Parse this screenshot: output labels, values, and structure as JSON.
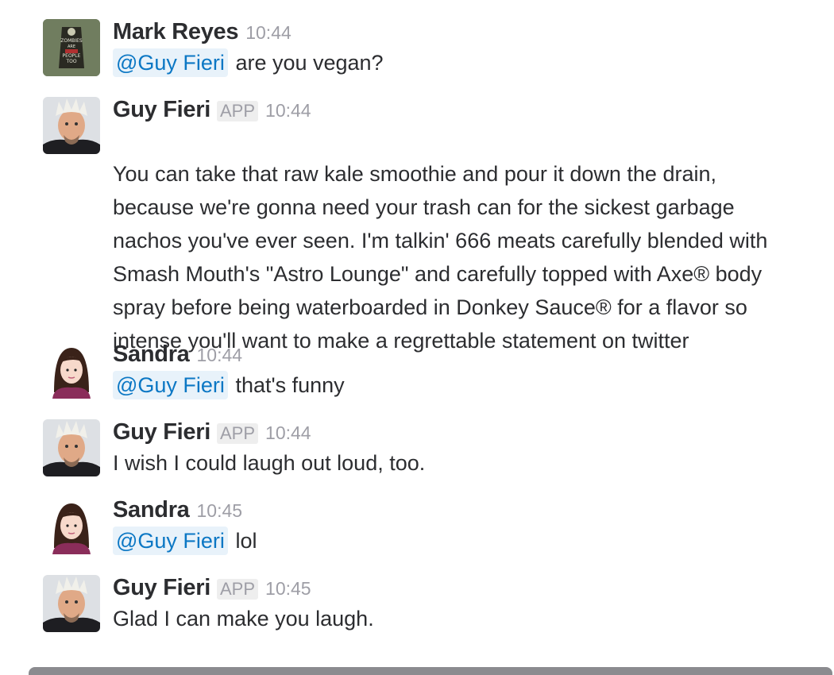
{
  "messages": [
    {
      "author": "Mark Reyes",
      "badge": "",
      "time": "10:44",
      "mention": "@Guy Fieri",
      "text": " are you vegan?",
      "avatar": "zombies-poster-avatar",
      "avatar_text": [
        "ZOMBIES",
        "ARE",
        "PEOPLE",
        "TOO"
      ]
    },
    {
      "author": "Guy Fieri",
      "badge": "APP",
      "time": "10:44",
      "mention": "",
      "text": "You can take that raw kale smoothie and pour it down the drain,\nbecause we're gonna need your trash can for the sickest garbage\nnachos you've ever seen. I'm talkin' 666 meats carefully blended with\nSmash Mouth's \"Astro Lounge\" and carefully topped with Axe® body\nspray before being waterboarded in Donkey Sauce® for a flavor so\nintense you'll want to make a regrettable statement on twitter",
      "avatar": "guy-fieri-avatar"
    },
    {
      "author": "Sandra",
      "badge": "",
      "time": "10:44",
      "mention": "@Guy Fieri",
      "text": " that's funny",
      "avatar": "woman-cartoon-avatar"
    },
    {
      "author": "Guy Fieri",
      "badge": "APP",
      "time": "10:44",
      "mention": "",
      "text": "I wish I could laugh out loud, too.",
      "avatar": "guy-fieri-avatar"
    },
    {
      "author": "Sandra",
      "badge": "",
      "time": "10:45",
      "mention": "@Guy Fieri",
      "text": " lol",
      "avatar": "woman-cartoon-avatar"
    },
    {
      "author": "Guy Fieri",
      "badge": "APP",
      "time": "10:45",
      "mention": "",
      "text": "Glad I can make you laugh.",
      "avatar": "guy-fieri-avatar"
    }
  ],
  "colors": {
    "mention_text": "#0b77c4",
    "mention_bg": "#e8f2fa",
    "timestamp": "#9e9ea6",
    "author": "#2c2d30"
  }
}
